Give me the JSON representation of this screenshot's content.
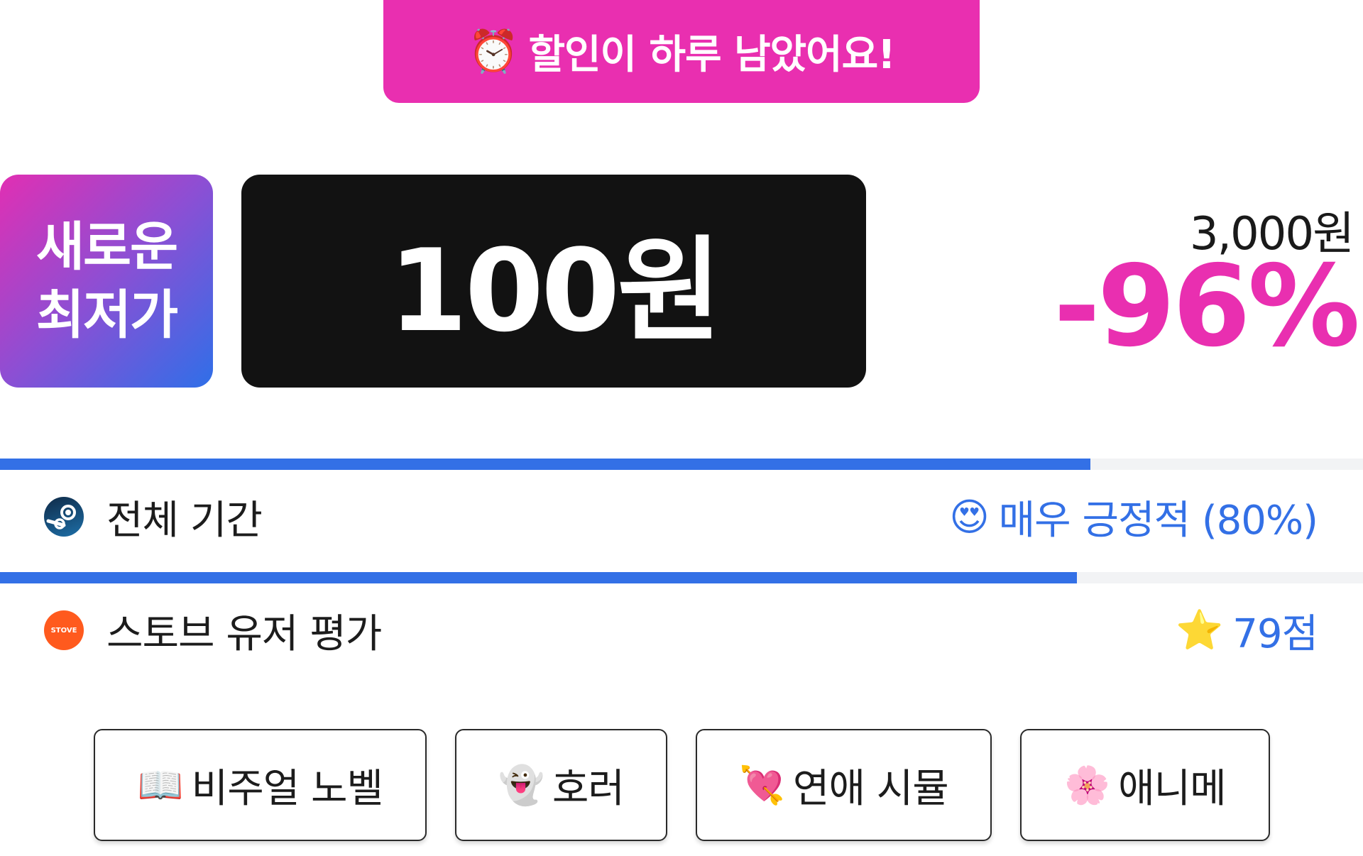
{
  "banner": {
    "icon": "alarm-clock",
    "icon_glyph": "⏰",
    "text": "할인이 하루 남았어요!"
  },
  "badge": {
    "line1": "새로운",
    "line2": "최저가"
  },
  "price": {
    "current": "100원",
    "original": "3,000원",
    "discount": "-96%"
  },
  "colors": {
    "accent_pink": "#e92fb0",
    "accent_blue": "#3370e6",
    "price_box": "#121212"
  },
  "ratings": [
    {
      "source_icon": "steam-icon",
      "label": "전체 기간",
      "value_icon_glyph": "😍",
      "value": "매우 긍정적 (80%)",
      "score_fraction": 0.8
    },
    {
      "source_icon": "stove-icon",
      "source_logo_text": "STOVE",
      "label": "스토브 유저 평가",
      "value_icon_glyph": "⭐",
      "value": "79점",
      "score_fraction": 0.79
    }
  ],
  "tags": [
    {
      "icon": "book-icon",
      "glyph": "📖",
      "label": "비주얼 노벨"
    },
    {
      "icon": "ghost-icon",
      "glyph": "👻",
      "label": "호러"
    },
    {
      "icon": "heart-arrow-icon",
      "glyph": "💘",
      "label": "연애 시뮬"
    },
    {
      "icon": "blossom-icon",
      "glyph": "🌸",
      "label": "애니메"
    }
  ]
}
